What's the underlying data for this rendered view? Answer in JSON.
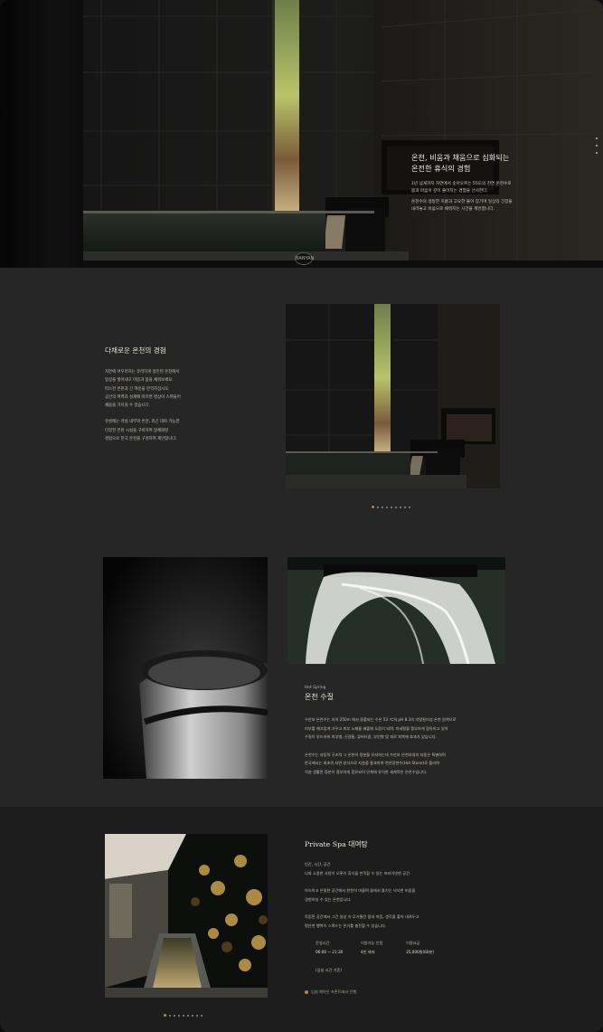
{
  "hero": {
    "title_line1": "온천, 비움과 채움으로 심화되는",
    "title_line2": "온전한 휴식의 경험",
    "body1_line1": "1년 넘게까지 자연에서 솟아오르는 55도의 천연 온천수로",
    "body1_line2": "몸과 마음이 깊이 풀어지는 경험을 선사한다.",
    "body2_line1": "온천수의 생동한 흐름과 고요한 물이 잠기며 일상의 긴장을",
    "body2_line2": "내려놓고 비움으로 채워지는 시간을 제안합니다.",
    "logo_text": "BANYAN"
  },
  "experience": {
    "title": "다채로운 온천의 경험",
    "p1_lines": [
      "자연에 어우러지는 유려하게 정돈된 온천에서",
      "일상을 벗어내고 마음과 몸을 채워보세요.",
      "따스한 온천과 긴 여운을 만끽하십시오.",
      "공간의 여백과 설계에 따르면 명상이 스며들어",
      "채움을 가지실 수 있습니다."
    ],
    "p2_lines": [
      "유원에는 객실 내부와 온천, 외곤 대야 가능한",
      "다양한 온천 시설을 구비하여 일체화된",
      "경험으로 한국 온천을 구성하여 제안합니다."
    ]
  },
  "hot_spring": {
    "kicker": "Hot Spring",
    "title": "온천 수질",
    "p1_lines": [
      "수안보 온천수는 지하 250m 에서 용출되는 수온 53 ℃의 pH 8.3의 약알칼리성 온천 원액으로",
      "피부를 매끄럽게 가꾸고 피부 노폐물 배출에 도움이 되며, 미네랄을 풍부하게 함유하고 있어",
      "수질이 부드러워 피부병, 신경통, 류머티즘, 부인병 및 피로 회복에 효과가 있습니다."
    ],
    "p2_lines": [
      "온천수는 자동적 구조적 그 온천의 정분을 유지하는데 수안보 온천지대의 자동은 특별하며",
      "한국에서는 최초의 자연 방식으로 지층을 통과하여 천연광천수(Hot Stone)로 불리며",
      "적층 생활된 정분이 풍부하게 함유되어 인체에 유익한 세계적인 온천수입니다."
    ]
  },
  "private_spa": {
    "title": "Private Spa 대여탕",
    "p1_lines": [
      "인간, 시간, 공간",
      "나와 소중한 사람이 오롯이 휴식을 만끽할 수 있는 프라이빗한 공간."
    ],
    "p2_lines": [
      "아늑하고 은밀한 공간에서 천천히 머물며 물에서 즐기는 넉넉한 비움을",
      "경험하실 수 있는 온천입니다."
    ],
    "p3_lines": [
      "독립된 공간에서 그간 일상 속 무거웠던 몸과 마음, 생각을 풀어 내려두고",
      "평온한 행복이 스며드는 온기를 충전할 수 있습니다."
    ],
    "info": [
      {
        "label": "운영시간",
        "value": "06:00 ~ 21:30"
      },
      {
        "label": "이용가능 인원",
        "value": "4인 까지"
      },
      {
        "label": "이용요금",
        "value": "35,000원(60분)"
      }
    ],
    "note": "(입실 시간 기준)",
    "link_text": "입실 예약은 프론트에서 진행"
  },
  "colors": {
    "background": "#262626",
    "dark_band": "#1d1d1d",
    "accent_gold": "#b5893e"
  }
}
